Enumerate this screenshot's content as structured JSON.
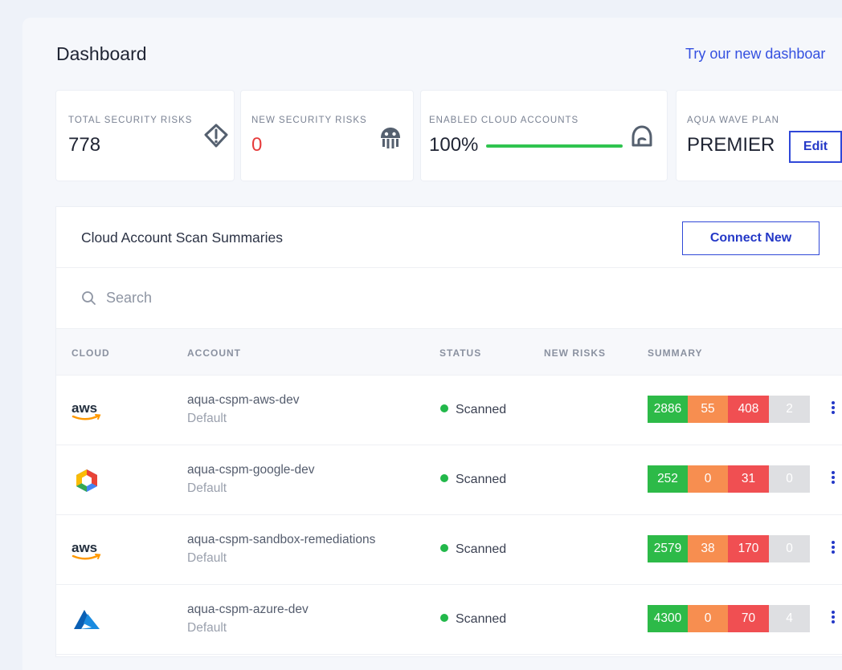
{
  "header": {
    "title": "Dashboard",
    "new_dashboard_link": "Try our new dashboar"
  },
  "cards": [
    {
      "label": "TOTAL SECURITY RISKS",
      "value": "778",
      "icon": "shield-alert-icon"
    },
    {
      "label": "NEW SECURITY RISKS",
      "value": "0",
      "icon": "jellyfish-icon",
      "value_color": "#e63b3b"
    },
    {
      "label": "ENABLED CLOUD ACCOUNTS",
      "value": "100%",
      "progress": 1.0,
      "icon": "cloud-shield-icon"
    },
    {
      "label": "AQUA WAVE PLAN",
      "value": "PREMIER",
      "edit_label": "Edit"
    }
  ],
  "panel": {
    "title": "Cloud Account Scan Summaries",
    "connect_label": "Connect New",
    "search_placeholder": "Search",
    "columns": [
      "CLOUD",
      "ACCOUNT",
      "STATUS",
      "NEW RISKS",
      "SUMMARY"
    ]
  },
  "rows": [
    {
      "cloud": "aws",
      "cloud_text": "aws",
      "account": "aqua-cspm-aws-dev",
      "sub": "Default",
      "status": "Scanned",
      "summary": [
        "2886",
        "55",
        "408",
        "2"
      ]
    },
    {
      "cloud": "google",
      "cloud_text": "",
      "account": "aqua-cspm-google-dev",
      "sub": "Default",
      "status": "Scanned",
      "summary": [
        "252",
        "0",
        "31",
        "0"
      ]
    },
    {
      "cloud": "aws",
      "cloud_text": "aws",
      "account": "aqua-cspm-sandbox-remediations",
      "sub": "Default",
      "status": "Scanned",
      "summary": [
        "2579",
        "38",
        "170",
        "0"
      ]
    },
    {
      "cloud": "azure",
      "cloud_text": "",
      "account": "aqua-cspm-azure-dev",
      "sub": "Default",
      "status": "Scanned",
      "summary": [
        "4300",
        "0",
        "70",
        "4"
      ]
    }
  ],
  "colors": {
    "accent": "#2438c7",
    "passed": "#2dba48",
    "warning": "#f78e50",
    "failed": "#f04f52",
    "unknown": "#dedfe2",
    "scanned_dot": "#22b84a"
  }
}
